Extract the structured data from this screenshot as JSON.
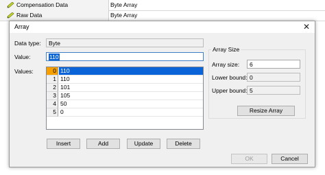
{
  "background": {
    "rows": [
      {
        "name": "Compensation Data",
        "value": "Byte Array"
      },
      {
        "name": "Raw Data",
        "value": "Byte Array"
      }
    ]
  },
  "dialog": {
    "title": "Array",
    "close_glyph": "✕",
    "data_type_label": "Data type:",
    "data_type_value": "Byte",
    "value_label": "Value:",
    "value_input": "110",
    "values_label": "Values:",
    "values": [
      {
        "index": "0",
        "value": "110",
        "selected": true
      },
      {
        "index": "1",
        "value": "110"
      },
      {
        "index": "2",
        "value": "101"
      },
      {
        "index": "3",
        "value": "105"
      },
      {
        "index": "4",
        "value": "50"
      },
      {
        "index": "5",
        "value": "0"
      }
    ],
    "array_size": {
      "group_label": "Array Size",
      "size_label": "Array size:",
      "size_value": "6",
      "lower_label": "Lower bound:",
      "lower_value": "0",
      "upper_label": "Upper bound:",
      "upper_value": "5",
      "resize_label": "Resize Array"
    },
    "buttons": {
      "insert": "Insert",
      "add": "Add",
      "update": "Update",
      "delete": "Delete",
      "ok": "OK",
      "cancel": "Cancel"
    },
    "colors": {
      "selection": "#0a64d8",
      "selected_index": "#f5a000",
      "pencil": "#c8d832"
    }
  }
}
